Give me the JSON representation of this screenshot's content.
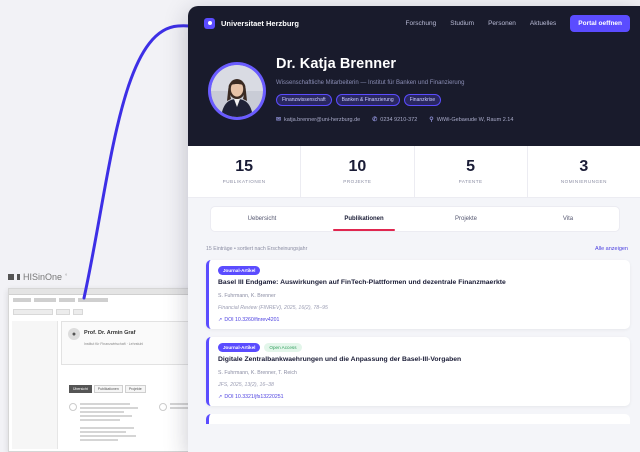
{
  "his": {
    "logo": "HISinOne",
    "name": "Prof. Dr. Armin Graf",
    "sub": "Institut für Finanzwirtschaft · Lehrstuhl",
    "btns": [
      "Übersicht",
      "Publikationen",
      "Projekte"
    ]
  },
  "nav": {
    "brand": "Universitaet Herzburg",
    "links": [
      "Forschung",
      "Studium",
      "Personen",
      "Aktuelles"
    ],
    "cta": "Portal oeffnen"
  },
  "profile": {
    "name": "Dr. Katja Brenner",
    "role": "Wissenschaftliche Mitarbeiterin — Institut für Banken und Finanzierung",
    "tags": [
      "Finanzwissenschaft",
      "Banken & Finanzierung",
      "Finanzkrise"
    ],
    "email": "katja.brenner@uni-herzburg.de",
    "phone": "0234 9210-372",
    "room": "WiWi-Gebaeude W, Raum 2.14"
  },
  "stats": [
    {
      "value": "15",
      "label": "PUBLIKATIONEN"
    },
    {
      "value": "10",
      "label": "PROJEKTE"
    },
    {
      "value": "5",
      "label": "PATENTE"
    },
    {
      "value": "3",
      "label": "NOMINIERUNGEN"
    }
  ],
  "tabs": [
    "Uebersicht",
    "Publikationen",
    "Projekte",
    "Vita"
  ],
  "active_tab": "Publikationen",
  "list": {
    "count": "15 Einträge • sortiert nach Erscheinungsjahr",
    "all_link": "Alle anzeigen"
  },
  "publications": [
    {
      "badge": "Journal-Artikel",
      "oa": "",
      "title": "Basel III Endgame: Auswirkungen auf FinTech-Plattformen und dezentrale Finanzmaerkte",
      "authors": "S. Fuhrmann, K. Brenner",
      "journal": "Financial Review (FINREV), 2025, 16(2), 78–95",
      "doi": "DOI 10.3260/finrev4201"
    },
    {
      "badge": "Journal-Artikel",
      "oa": "Open Access",
      "title": "Digitale Zentralbankwaehrungen und die Anpassung der Basel-III-Vorgaben",
      "authors": "S. Fuhrmann, K. Brenner, T. Reich",
      "journal": "JFS, 2025, 13(2), 16–38",
      "doi": "DOI 10.3321/jfs13220251"
    }
  ],
  "colors": {
    "accent": "#5b4cff",
    "hero": "#191b2c",
    "tab_underline": "#e0264f"
  }
}
